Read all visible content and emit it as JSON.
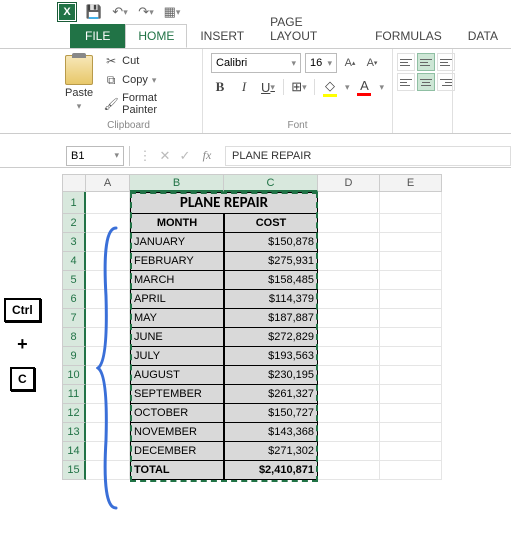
{
  "qat": {
    "excel": "X",
    "save": "💾"
  },
  "tabs": {
    "file": "FILE",
    "home": "HOME",
    "insert": "INSERT",
    "pagelayout": "PAGE LAYOUT",
    "formulas": "FORMULAS",
    "data": "DATA"
  },
  "ribbon": {
    "clipboard": {
      "label": "Clipboard",
      "paste": "Paste",
      "cut": "Cut",
      "copy": "Copy",
      "formatpainter": "Format Painter"
    },
    "font": {
      "label": "Font",
      "name": "Calibri",
      "size": "16",
      "bold": "B",
      "italic": "I",
      "underline": "U"
    },
    "alignment": {
      "label": ""
    }
  },
  "formula_bar": {
    "namebox": "B1",
    "fx": "fx",
    "value": "PLANE REPAIR"
  },
  "columns": [
    "A",
    "B",
    "C",
    "D",
    "E"
  ],
  "rownums": [
    "1",
    "2",
    "3",
    "4",
    "5",
    "6",
    "7",
    "8",
    "9",
    "10",
    "11",
    "12",
    "13",
    "14",
    "15"
  ],
  "sheet": {
    "title": "PLANE REPAIR",
    "headers": {
      "month": "MONTH",
      "cost": "COST"
    },
    "rows": [
      {
        "month": "JANUARY",
        "cost": "$150,878"
      },
      {
        "month": "FEBRUARY",
        "cost": "$275,931"
      },
      {
        "month": "MARCH",
        "cost": "$158,485"
      },
      {
        "month": "APRIL",
        "cost": "$114,379"
      },
      {
        "month": "MAY",
        "cost": "$187,887"
      },
      {
        "month": "JUNE",
        "cost": "$272,829"
      },
      {
        "month": "JULY",
        "cost": "$193,563"
      },
      {
        "month": "AUGUST",
        "cost": "$230,195"
      },
      {
        "month": "SEPTEMBER",
        "cost": "$261,327"
      },
      {
        "month": "OCTOBER",
        "cost": "$150,727"
      },
      {
        "month": "NOVEMBER",
        "cost": "$143,368"
      },
      {
        "month": "DECEMBER",
        "cost": "$271,302"
      }
    ],
    "total": {
      "label": "TOTAL",
      "value": "$2,410,871"
    }
  },
  "keys": {
    "ctrl": "Ctrl",
    "plus": "+",
    "c": "C"
  }
}
